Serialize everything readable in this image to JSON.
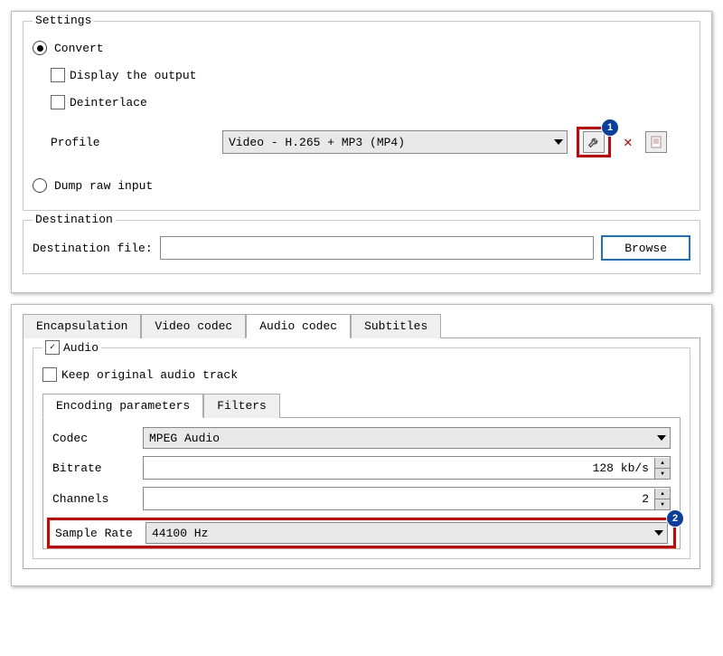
{
  "settings": {
    "legend": "Settings",
    "convert_label": "Convert",
    "display_output_label": "Display the output",
    "deinterlace_label": "Deinterlace",
    "profile_label": "Profile",
    "profile_value": "Video - H.265 + MP3 (MP4)",
    "dump_raw_label": "Dump raw input"
  },
  "destination": {
    "legend": "Destination",
    "file_label": "Destination file:",
    "file_value": "",
    "browse_label": "Browse"
  },
  "tabs": {
    "encapsulation": "Encapsulation",
    "video_codec": "Video codec",
    "audio_codec": "Audio codec",
    "subtitles": "Subtitles"
  },
  "audio": {
    "audio_label": "Audio",
    "keep_original_label": "Keep original audio track",
    "subtab_encoding": "Encoding parameters",
    "subtab_filters": "Filters",
    "codec_label": "Codec",
    "codec_value": "MPEG Audio",
    "bitrate_label": "Bitrate",
    "bitrate_value": "128 kb/s",
    "channels_label": "Channels",
    "channels_value": "2",
    "samplerate_label": "Sample Rate",
    "samplerate_value": "44100 Hz"
  },
  "badges": {
    "one": "1",
    "two": "2"
  }
}
